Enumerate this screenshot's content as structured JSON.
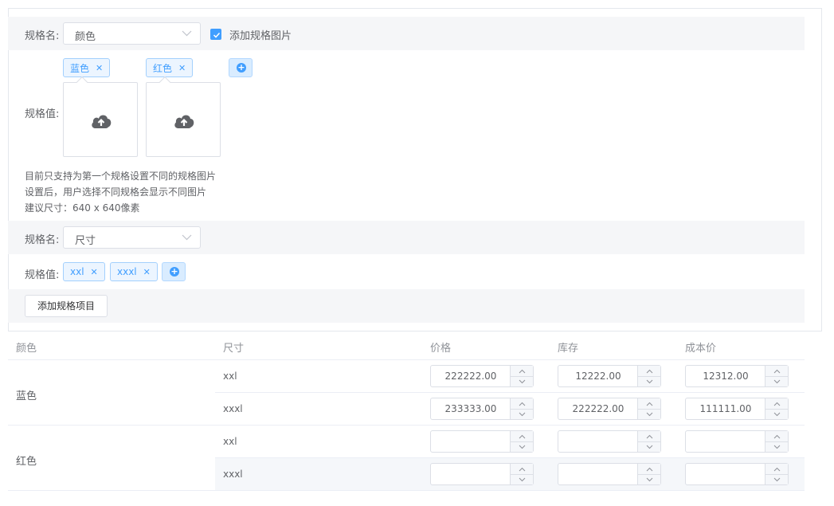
{
  "spec_panel": {
    "spec1": {
      "name_label": "规格名:",
      "name_value": "颜色",
      "checkbox_label": "添加规格图片",
      "value_label": "规格值:",
      "values": [
        "蓝色",
        "红色"
      ],
      "hint_lines": [
        "目前只支持为第一个规格设置不同的规格图片",
        "设置后，用户选择不同规格会显示不同图片",
        "建议尺寸：640 x 640像素"
      ]
    },
    "spec2": {
      "name_label": "规格名:",
      "name_value": "尺寸",
      "value_label": "规格值:",
      "values": [
        "xxl",
        "xxxl"
      ]
    },
    "add_spec_button": "添加规格项目"
  },
  "table": {
    "headers": [
      "颜色",
      "尺寸",
      "价格",
      "库存",
      "成本价"
    ],
    "groups": [
      {
        "color": "蓝色",
        "rows": [
          {
            "size": "xxl",
            "price": "222222.00",
            "stock": "12222.00",
            "cost": "12312.00"
          },
          {
            "size": "xxxl",
            "price": "233333.00",
            "stock": "222222.00",
            "cost": "111111.00"
          }
        ]
      },
      {
        "color": "红色",
        "rows": [
          {
            "size": "xxl",
            "price": "",
            "stock": "",
            "cost": ""
          },
          {
            "size": "xxxl",
            "price": "",
            "stock": "",
            "cost": ""
          }
        ]
      }
    ]
  },
  "colors": {
    "accent": "#409eff",
    "tag_bg": "#ecf5ff",
    "panel_bg": "#f5f6f8"
  }
}
